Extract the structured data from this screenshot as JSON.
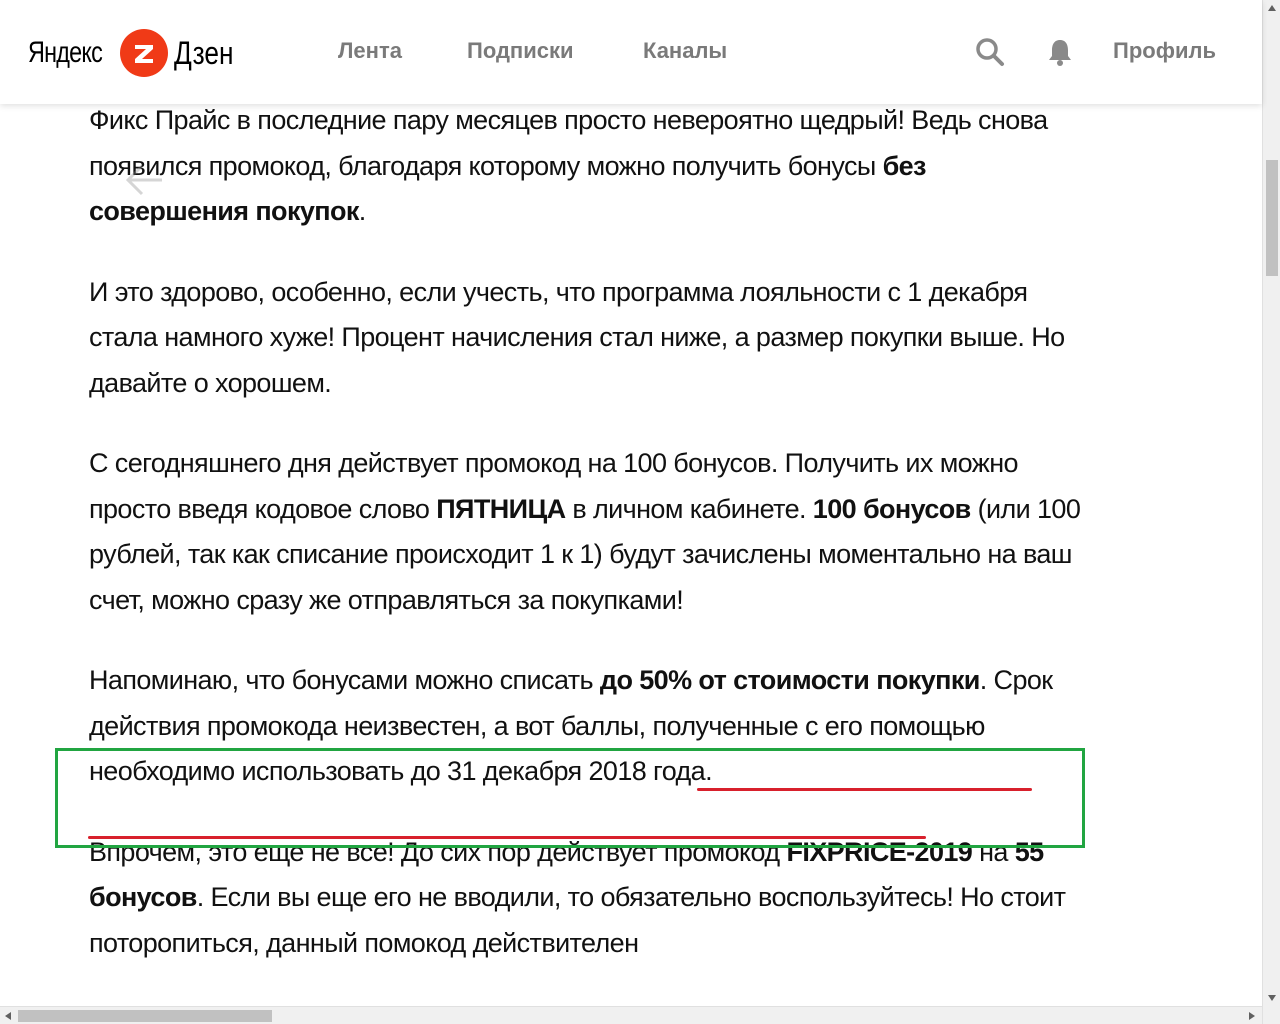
{
  "header": {
    "logo_left": "Яндекс",
    "logo_right": "Дзен",
    "nav": [
      "Лента",
      "Подписки",
      "Каналы"
    ],
    "profile_label": "Профиль",
    "icons": [
      "search-icon",
      "bell-icon"
    ]
  },
  "article": {
    "p1": {
      "text1": "Фикс Прайс в последние пару месяцев просто невероятно щедрый! Ведь снова появился промокод, благодаря которому можно получить бонусы ",
      "bold1": "без совершения покупок",
      "text2": "."
    },
    "p2": {
      "text1": "И это здорово, особенно, если учесть, что программа лояльности с 1 декабря стала намного хуже! Процент начисления стал ниже, а размер покупки выше. Но давайте о хорошем."
    },
    "p3": {
      "text1": "С сегодняшнего дня действует промокод на 100 бонусов. Получить их можно просто введя кодовое слово ",
      "bold1": "ПЯТНИЦА",
      "text2": " в личном кабинете. ",
      "bold2": "100 бонусов",
      "text3": " (или 100 рублей, так как списание происходит 1 к 1) будут зачислены моментально на ваш счет, можно сразу же отправляться за покупками!"
    },
    "p4": {
      "text1": "Напоминаю, что бонусами можно списать ",
      "bold1": "до 50% от стоимости покупки",
      "text2": ". Срок действия промокода неизвестен, а вот баллы, полученные с его помощью необходимо использовать до 31 декабря 2018 года."
    },
    "p5": {
      "text1": "Впрочем, это еще не все! До сих пор действует промокод ",
      "bold1": "FIXPRICE-2019",
      "text2": " на ",
      "bold2": "55 бонусов",
      "text3": ". Если вы еще его не вводили, то обязательно воспользуйтесь! Но стоит поторопиться, данный помокод действителен"
    }
  },
  "colors": {
    "brand_red": "#f03a17",
    "highlight_green": "#21a541",
    "underline_red": "#d8202c",
    "nav_gray": "#7a7a7a"
  }
}
